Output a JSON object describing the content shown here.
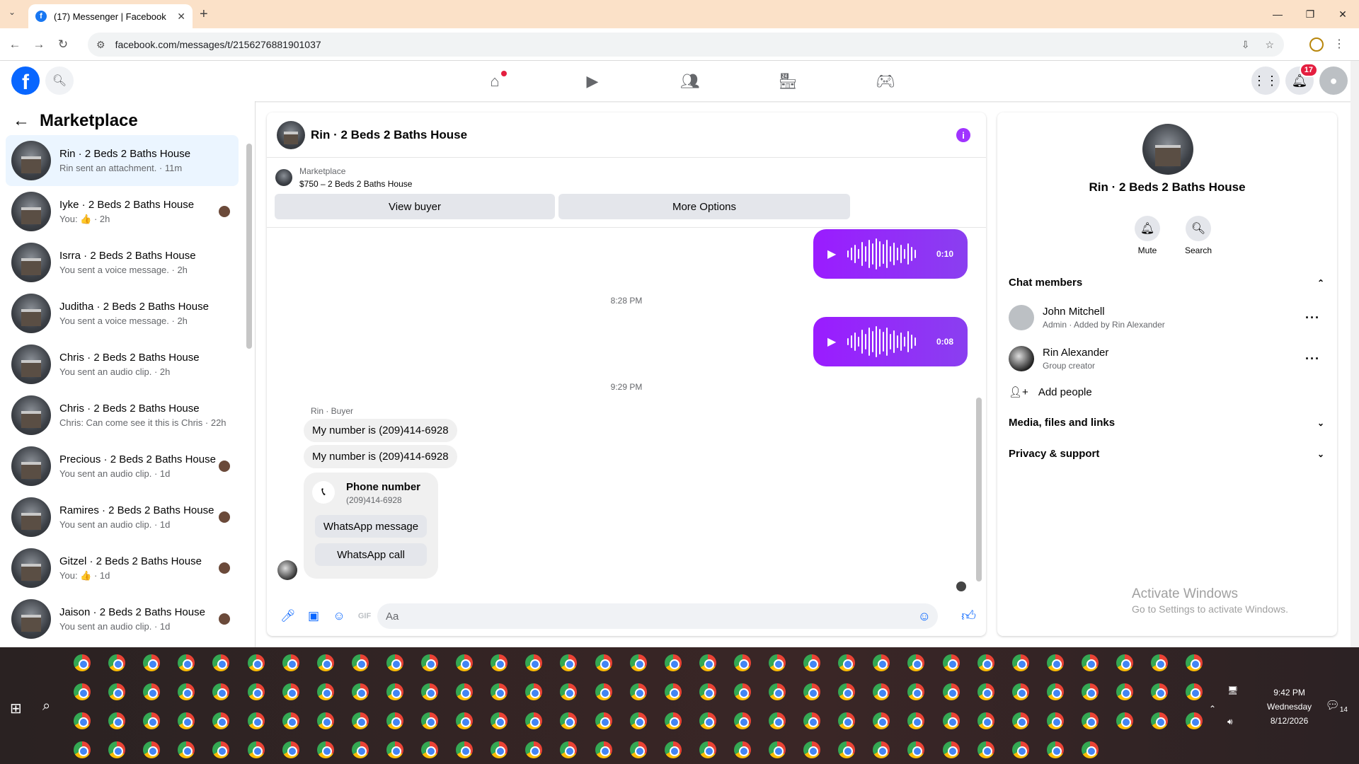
{
  "browser": {
    "tab_title": "(17) Messenger | Facebook",
    "url": "facebook.com/messages/t/2156276881901037"
  },
  "fbnav": {
    "notifications_count": "17",
    "nav_icons": [
      "home-icon",
      "video-icon",
      "friends-icon",
      "marketplace-icon",
      "gaming-icon"
    ]
  },
  "sidebar": {
    "title": "Marketplace",
    "conversations": [
      {
        "title": "Rin · 2 Beds 2 Baths House",
        "sub": "Rin sent an attachment. · 11m",
        "active": true
      },
      {
        "title": "Iyke · 2 Beds 2 Baths House",
        "sub": "You: 👍 · 2h"
      },
      {
        "title": "Isrra · 2 Beds 2 Baths House",
        "sub": "You sent a voice message. · 2h"
      },
      {
        "title": "Juditha · 2 Beds 2 Baths House",
        "sub": "You sent a voice message. · 2h"
      },
      {
        "title": "Chris · 2 Beds 2 Baths House",
        "sub": "You sent an audio clip. · 2h"
      },
      {
        "title": "Chris · 2 Beds 2 Baths House",
        "sub": "Chris: Can come see it this is Chris · 22h"
      },
      {
        "title": "Precious · 2 Beds 2 Baths House",
        "sub": "You sent an audio clip. · 1d"
      },
      {
        "title": "Ramires · 2 Beds 2 Baths House",
        "sub": "You sent an audio clip. · 1d"
      },
      {
        "title": "Gitzel · 2 Beds 2 Baths House",
        "sub": "You: 👍 · 1d"
      },
      {
        "title": "Jaison · 2 Beds 2 Baths House",
        "sub": "You sent an audio clip. · 1d"
      }
    ]
  },
  "chat": {
    "title": "Rin · 2 Beds 2 Baths House",
    "listing_label": "Marketplace",
    "listing_price": "$750 – 2 Beds 2 Baths House",
    "view_buyer": "View buyer",
    "more_options": "More Options",
    "audio1_duration": "0:10",
    "time1": "8:28 PM",
    "audio2_duration": "0:08",
    "time2": "9:29 PM",
    "sender": "Rin · Buyer",
    "msg1": "My number is (209)414-6928",
    "msg2": "My number is (209)414-6928",
    "phone_title": "Phone number",
    "phone_number": "(209)414-6928",
    "whatsapp_message": "WhatsApp message",
    "whatsapp_call": "WhatsApp call",
    "composer_placeholder": "Aa"
  },
  "details": {
    "name": "Rin · 2 Beds 2 Baths House",
    "mute": "Mute",
    "search": "Search",
    "chat_members": "Chat members",
    "members": [
      {
        "name": "John Mitchell",
        "sub": "Admin · Added by Rin Alexander"
      },
      {
        "name": "Rin Alexander",
        "sub": "Group creator"
      }
    ],
    "add_people": "Add people",
    "media": "Media, files and links",
    "privacy": "Privacy & support",
    "activate_title": "Activate Windows",
    "activate_sub": "Go to Settings to activate Windows."
  },
  "taskbar": {
    "time": "9:42 PM",
    "day": "Wednesday",
    "date": "8/12/2026",
    "notif_count": "14"
  }
}
